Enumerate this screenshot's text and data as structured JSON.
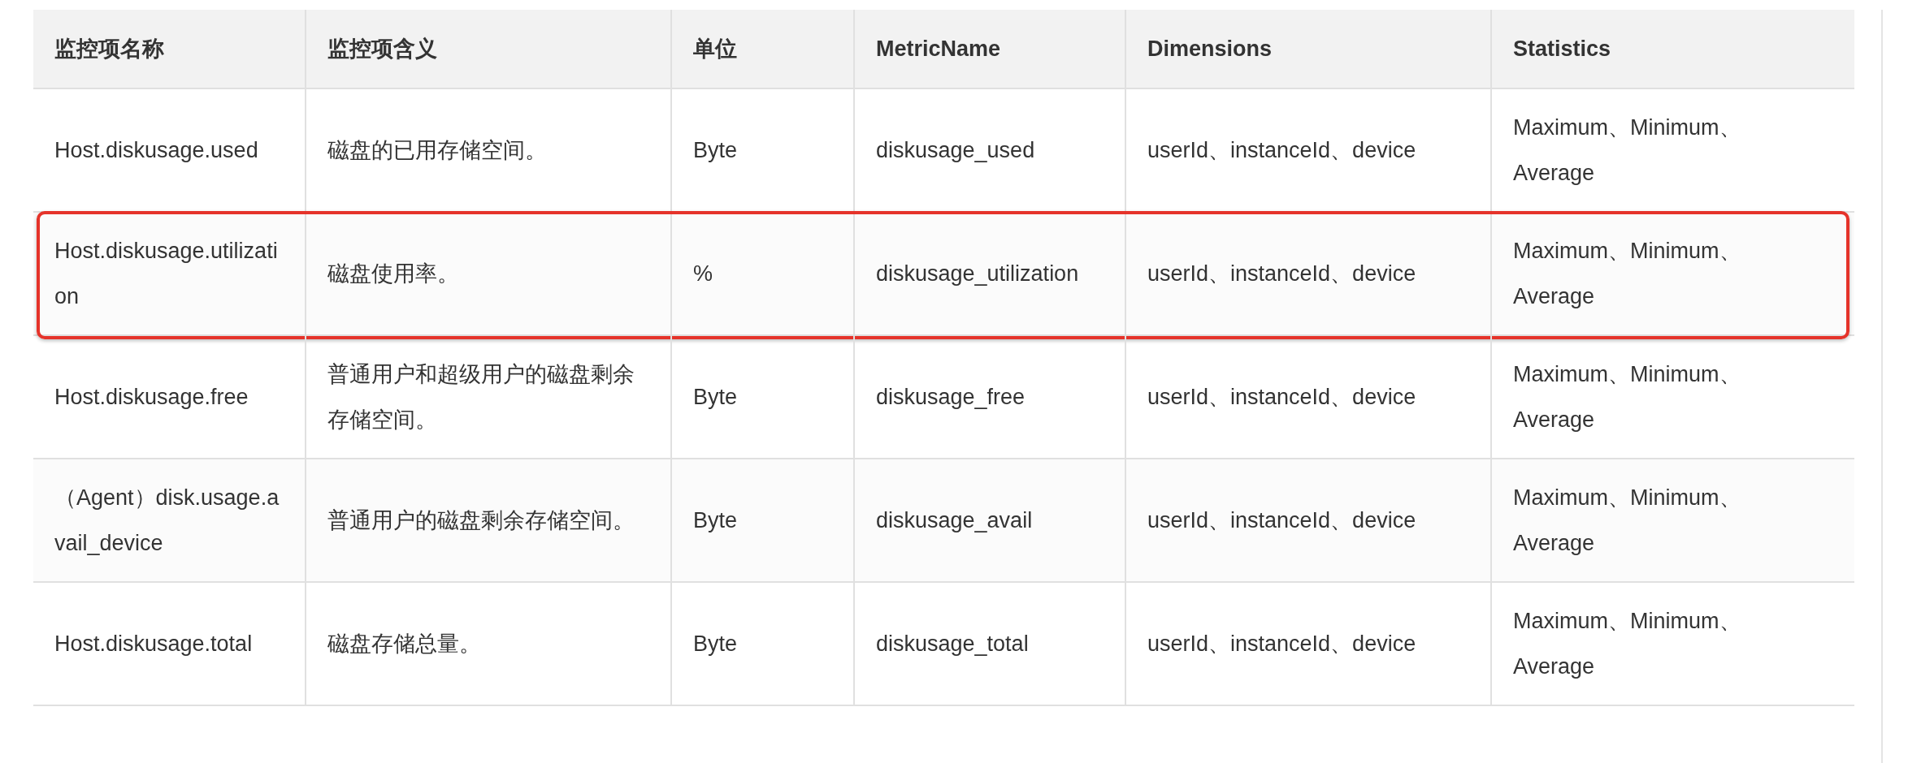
{
  "table": {
    "columns": [
      "监控项名称",
      "监控项含义",
      "单位",
      "MetricName",
      "Dimensions",
      "Statistics"
    ],
    "rows": [
      {
        "cells": [
          "Host.diskusage.used",
          "磁盘的已用存储空间。",
          "Byte",
          "diskusage_used",
          "userId、instanceId、device",
          "Maximum、Minimum、Average"
        ],
        "highlighted": false
      },
      {
        "cells": [
          "Host.diskusage.utilization",
          "磁盘使用率。",
          "%",
          "diskusage_utilization",
          "userId、instanceId、device",
          "Maximum、Minimum、Average"
        ],
        "highlighted": true
      },
      {
        "cells": [
          "Host.diskusage.free",
          "普通用户和超级用户的磁盘剩余存储空间。",
          "Byte",
          "diskusage_free",
          "userId、instanceId、device",
          "Maximum、Minimum、Average"
        ],
        "highlighted": false
      },
      {
        "cells": [
          "（Agent）disk.usage.avail_device",
          "普通用户的磁盘剩余存储空间。",
          "Byte",
          "diskusage_avail",
          "userId、instanceId、device",
          "Maximum、Minimum、Average"
        ],
        "highlighted": false
      },
      {
        "cells": [
          "Host.diskusage.total",
          "磁盘存储总量。",
          "Byte",
          "diskusage_total",
          "userId、instanceId、device",
          "Maximum、Minimum、Average"
        ],
        "highlighted": false
      }
    ]
  }
}
